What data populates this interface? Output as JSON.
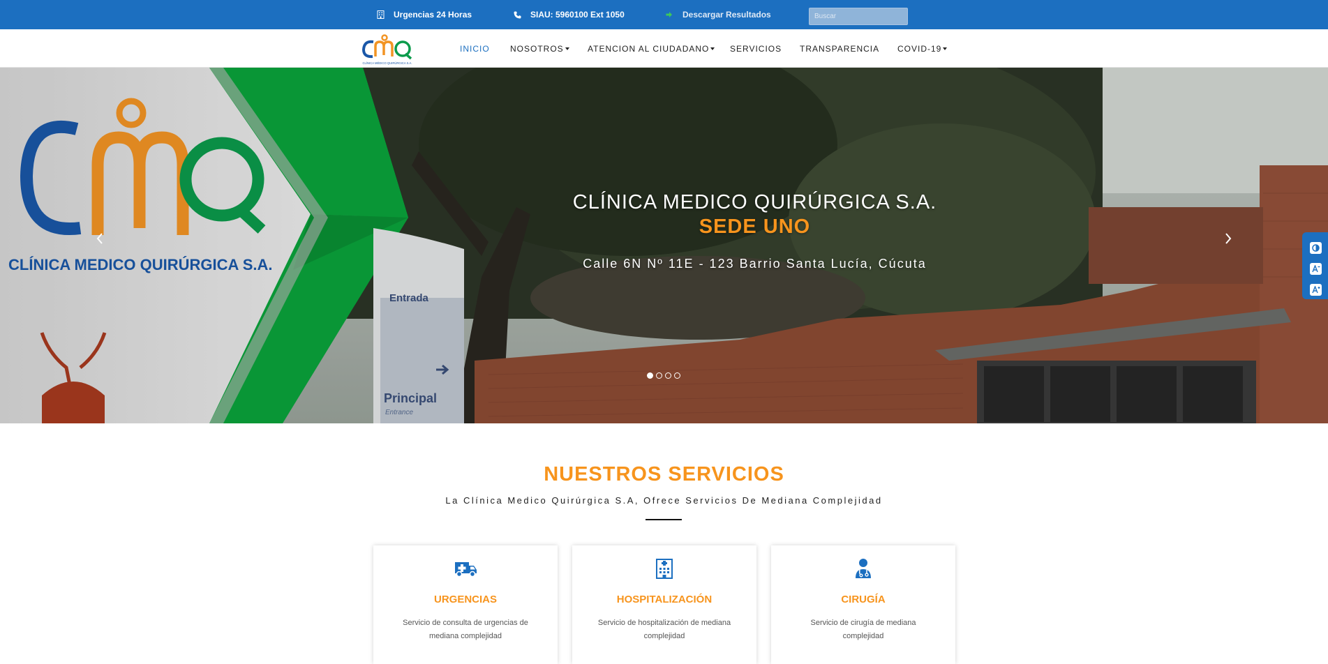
{
  "topbar": {
    "emergency_label": "Urgencias 24 Horas",
    "siau_label": "SIAU: 5960100 Ext 1050",
    "download_label": "Descargar Resultados",
    "search_placeholder": "Buscar"
  },
  "brand": {
    "logo_text": "CMQ",
    "logo_caption": "CLÍNICA MÉDICO QUIRÚRGICA S.A."
  },
  "nav": {
    "items": [
      {
        "label": "INICIO",
        "active": true
      },
      {
        "label": "NOSOTROS",
        "dropdown": true
      },
      {
        "label": "ATENCION AL CIUDADANO",
        "dropdown": true
      },
      {
        "label": "SERVICIOS"
      },
      {
        "label": "TRANSPARENCIA"
      },
      {
        "label": "COVID-19",
        "dropdown": true
      }
    ]
  },
  "hero": {
    "title": "CLÍNICA MEDICO QUIRÚRGICA S.A.",
    "subtitle": "SEDE UNO",
    "address": "Calle 6N Nº 11E - 123 Barrio Santa Lucía, Cúcuta",
    "banner_brand": "CLÍNICA MEDICO QUIRÚRGICA S.A.",
    "sign_text_1": "Entrada",
    "sign_text_2": "Principal",
    "sign_text_3": "Entrance",
    "slide_count": 4,
    "active_slide": 1
  },
  "services": {
    "title": "NUESTROS SERVICIOS",
    "subtitle": "La Clínica Medico Quirúrgica S.A, Ofrece Servicios De Mediana Complejidad",
    "cards": [
      {
        "title": "URGENCIAS",
        "text": "Servicio de consulta de urgencias de mediana complejidad",
        "icon": "ambulance-icon"
      },
      {
        "title": "HOSPITALIZACIÓN",
        "text": "Servicio de hospitalización de mediana complejidad",
        "icon": "hospital-icon"
      },
      {
        "title": "CIRUGÍA",
        "text": "Servicio de cirugía de mediana complejidad",
        "icon": "doctor-icon"
      }
    ]
  },
  "colors": {
    "primary_blue": "#1c6fc0",
    "accent_orange": "#f7941d",
    "brand_green": "#0aa33b"
  }
}
